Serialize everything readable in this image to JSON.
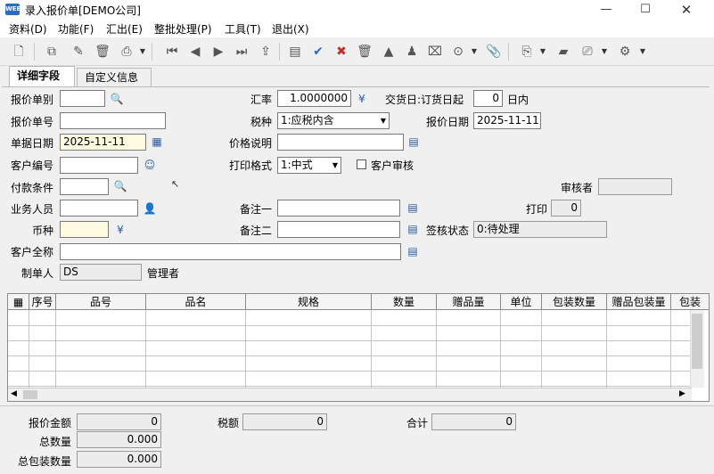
{
  "window": {
    "title": "录入报价单[DEMO公司]",
    "icon_text": "WEB"
  },
  "menu": [
    "资料(D)",
    "功能(F)",
    "汇出(E)",
    "整批处理(P)",
    "工具(T)",
    "退出(X)"
  ],
  "tabs": [
    "详细字段",
    "自定义信息"
  ],
  "form": {
    "quote_type_label": "报价单别",
    "quote_no_label": "报价单号",
    "doc_date_label": "单据日期",
    "doc_date": "2025-11-11",
    "customer_no_label": "客户编号",
    "payment_label": "付款条件",
    "salesperson_label": "业务人员",
    "currency_label": "币种",
    "customer_name_label": "客户全称",
    "creator_label": "制单人",
    "creator_value": "DS",
    "creator_name": "管理者",
    "rate_label": "汇率",
    "rate_value": "1.0000000",
    "tax_label": "税种",
    "tax_value": "1:应税内含",
    "price_desc_label": "价格说明",
    "print_format_label": "打印格式",
    "print_format_value": "1:中式",
    "customer_review_label": "客户审核",
    "remark1_label": "备注一",
    "remark2_label": "备注二",
    "delivery_label": "交货日:订货日起",
    "delivery_days": "0",
    "delivery_unit": "日内",
    "quote_date_label": "报价日期",
    "quote_date": "2025-11-11",
    "reviewer_label": "审核者",
    "print_label": "打印",
    "print_count": "0",
    "sign_status_label": "签核状态",
    "sign_status_value": "0:待处理"
  },
  "grid": {
    "columns": [
      "序号",
      "品号",
      "品名",
      "规格",
      "数量",
      "赠品量",
      "单位",
      "包装数量",
      "赠品包装量",
      "包装"
    ]
  },
  "totals": {
    "amount_label": "报价金额",
    "amount_value": "0",
    "tax_label": "税额",
    "tax_value": "0",
    "total_label": "合计",
    "total_value": "0",
    "qty_label": "总数量",
    "qty_value": "0.000",
    "pack_qty_label": "总包装数量",
    "pack_qty_value": "0.000"
  },
  "icons": {
    "toolbar": [
      "new-doc",
      "edit",
      "delete",
      "print",
      "first",
      "prev",
      "next",
      "last",
      "export",
      "form",
      "confirm",
      "cancel",
      "trash",
      "approve",
      "unapprove",
      "void",
      "more",
      "attach",
      "copy",
      "folder",
      "preview",
      "settings"
    ]
  }
}
